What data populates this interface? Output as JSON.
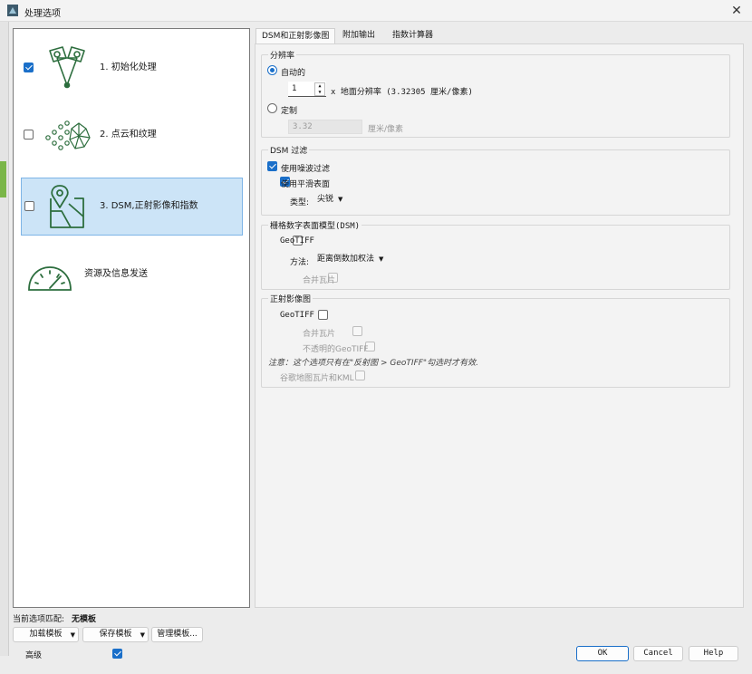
{
  "window": {
    "title": "处理选项",
    "close": "✕"
  },
  "steps": [
    {
      "label": "1. 初始化处理",
      "checked": true,
      "icon": "initial-processing-icon"
    },
    {
      "label": "2. 点云和纹理",
      "checked": false,
      "icon": "point-cloud-icon"
    },
    {
      "label": "3. DSM,正射影像和指数",
      "checked": false,
      "icon": "map-pin-icon",
      "selected": true
    },
    {
      "label": "资源及信息发送",
      "icon": "gauge-icon"
    }
  ],
  "tabs": [
    "DSM和正射影像图",
    "附加输出",
    "指数计算器"
  ],
  "resolution": {
    "title": "分辨率",
    "auto_label": "自动的",
    "auto_value": "1",
    "auto_suffix": "x 地面分辨率 (3.32305 厘米/像素)",
    "custom_label": "定制",
    "custom_value": "3.32",
    "custom_unit": "厘米/像素"
  },
  "dsm_filter": {
    "title": "DSM 过滤",
    "noise_label": "使用噪波过滤",
    "smooth_label": "使用平滑表面",
    "type_label": "类型:",
    "type_value": "尖锐"
  },
  "raster_dsm": {
    "title": "栅格数字表面模型(DSM)",
    "geotiff_label": "GeoTIFF",
    "method_label": "方法:",
    "method_value": "距离倒数加权法",
    "merge_label": "合并瓦片"
  },
  "ortho": {
    "title": "正射影像图",
    "geotiff_label": "GeoTIFF",
    "merge_label": "合并瓦片",
    "opaque_label": "不透明的GeoTIFF",
    "note": "注意：这个选项只有在\"反射图 > GeoTIFF\"勾选时才有效.",
    "kml_label": "谷歌地图瓦片和KML"
  },
  "template": {
    "current_label": "当前选项匹配:",
    "current_value": "无模板",
    "load": "加载模板",
    "save": "保存模板",
    "manage": "管理模板..."
  },
  "advanced_label": "高级",
  "buttons": {
    "ok": "OK",
    "cancel": "Cancel",
    "help": "Help"
  },
  "colors": {
    "accent": "#1a6fc9",
    "icon_green": "#2d6e3e",
    "selected_bg": "#cce4f7"
  }
}
